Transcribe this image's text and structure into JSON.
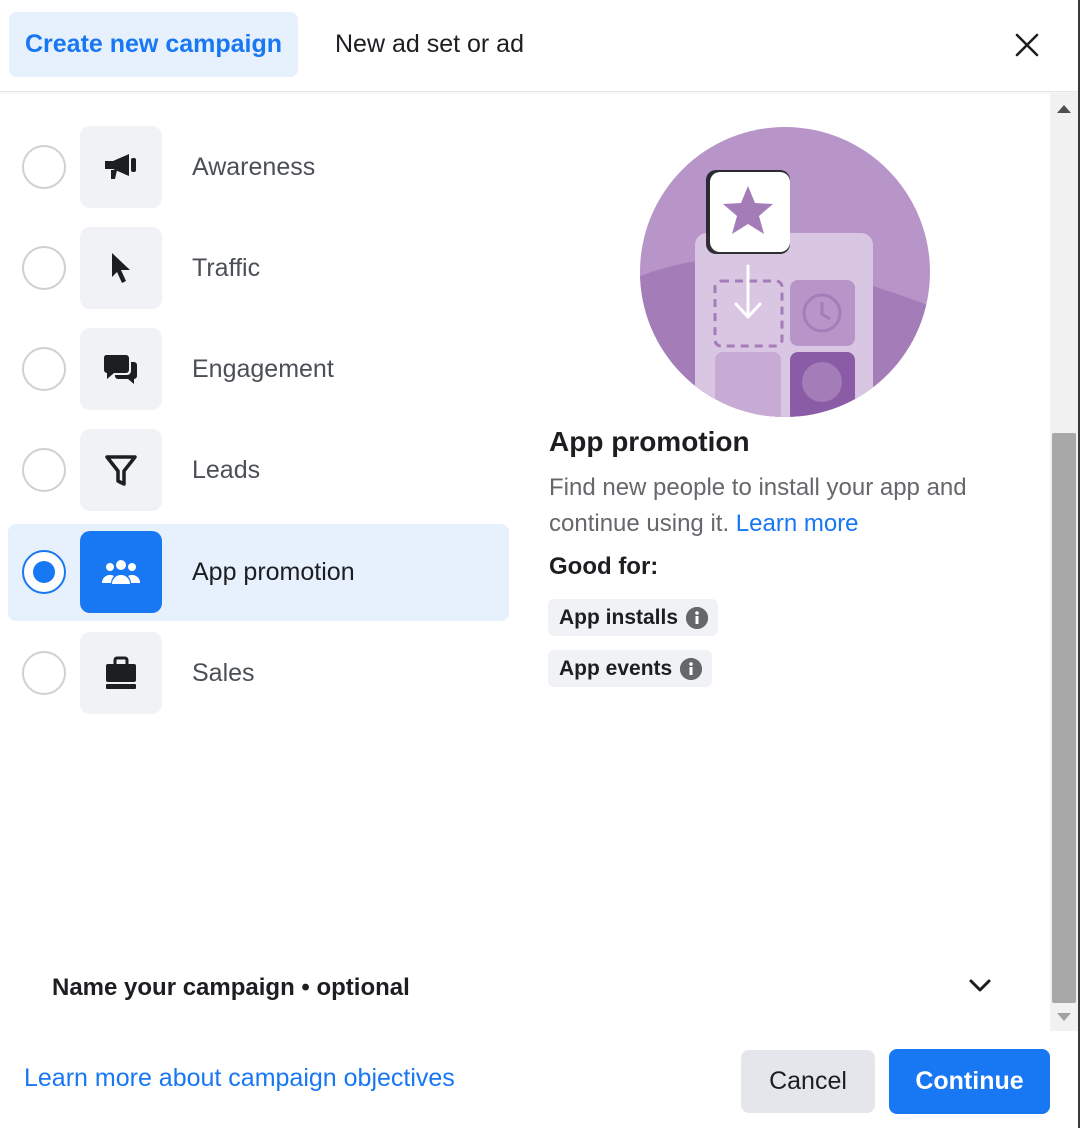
{
  "header": {
    "tabs": [
      {
        "label": "Create new campaign",
        "active": true
      },
      {
        "label": "New ad set or ad",
        "active": false
      }
    ],
    "close_icon": "close-icon"
  },
  "objectives": [
    {
      "label": "Awareness",
      "icon": "megaphone-icon",
      "selected": false
    },
    {
      "label": "Traffic",
      "icon": "cursor-icon",
      "selected": false
    },
    {
      "label": "Engagement",
      "icon": "chat-bubbles-icon",
      "selected": false
    },
    {
      "label": "Leads",
      "icon": "funnel-icon",
      "selected": false
    },
    {
      "label": "App promotion",
      "icon": "people-group-icon",
      "selected": true
    },
    {
      "label": "Sales",
      "icon": "shopping-bag-icon",
      "selected": false
    }
  ],
  "detail": {
    "title": "App promotion",
    "description": "Find new people to install your app and continue using it.",
    "learn_more": "Learn more",
    "good_for_label": "Good for:",
    "chips": [
      {
        "label": "App installs",
        "icon": "info-icon"
      },
      {
        "label": "App events",
        "icon": "info-icon"
      }
    ],
    "illustration": "app-download-illustration"
  },
  "name_campaign": {
    "label": "Name your campaign • optional",
    "icon": "chevron-down-icon"
  },
  "footer": {
    "learn_link": "Learn more about campaign objectives",
    "cancel_label": "Cancel",
    "continue_label": "Continue"
  },
  "colors": {
    "accent": "#1877f2",
    "selected_bg": "#e7f0fd",
    "illustration_purple": "#b895c8"
  }
}
